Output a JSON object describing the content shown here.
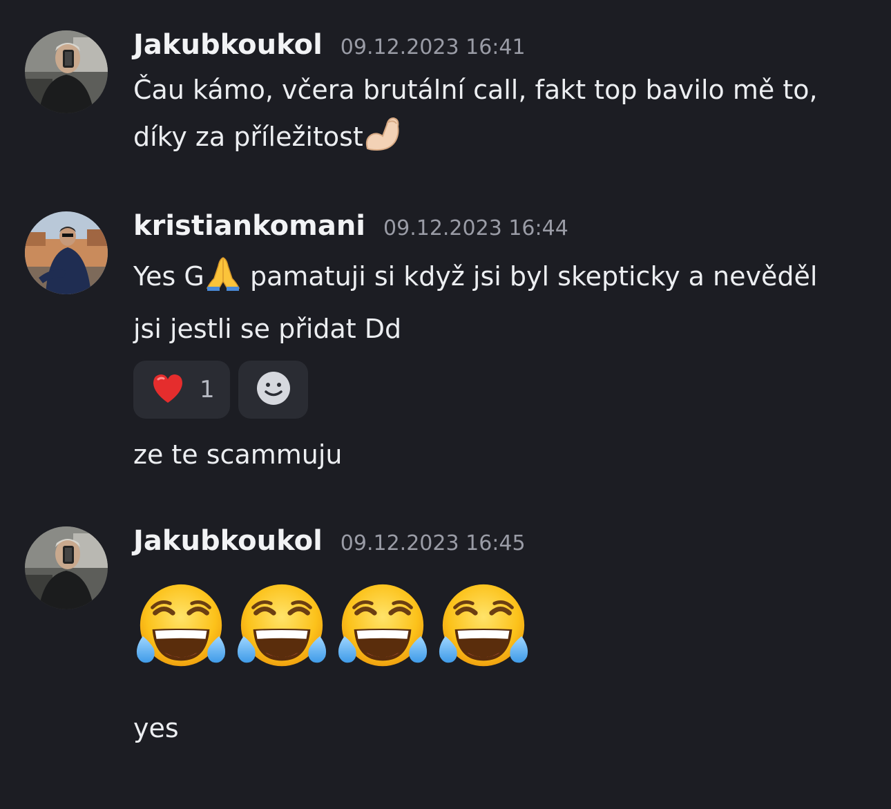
{
  "messages": [
    {
      "username": "Jakubkoukol",
      "timestamp": "09.12.2023 16:41",
      "line1": "Čau kámo, včera brutální call, fakt top bavilo mě to,",
      "line2": "díky za příležitost",
      "line2_emoji": "flexed-biceps-icon"
    },
    {
      "username": "kristiankomani",
      "timestamp": "09.12.2023 16:44",
      "line1_start": "Yes G",
      "line1_emoji": "folded-hands-icon",
      "line1_end": " pamatuji si když jsi byl skepticky a nevěděl",
      "line2": "jsi jestli se přidat Dd",
      "reaction": {
        "emoji": "red-heart-icon",
        "count": "1"
      },
      "add_reaction_icon": "add-reaction-smiley-icon",
      "followup": "ze te scammuju"
    },
    {
      "username": "Jakubkoukol",
      "timestamp": "09.12.2023 16:45",
      "big_emojis": [
        "tears-of-joy-icon",
        "tears-of-joy-icon",
        "tears-of-joy-icon",
        "tears-of-joy-icon"
      ],
      "followup": "yes"
    }
  ],
  "colors": {
    "background": "#1c1d23",
    "username": "#f2f3f5",
    "timestamp": "#9a9ca6",
    "text": "#eceef1",
    "reaction_bg": "#2a2c33"
  }
}
